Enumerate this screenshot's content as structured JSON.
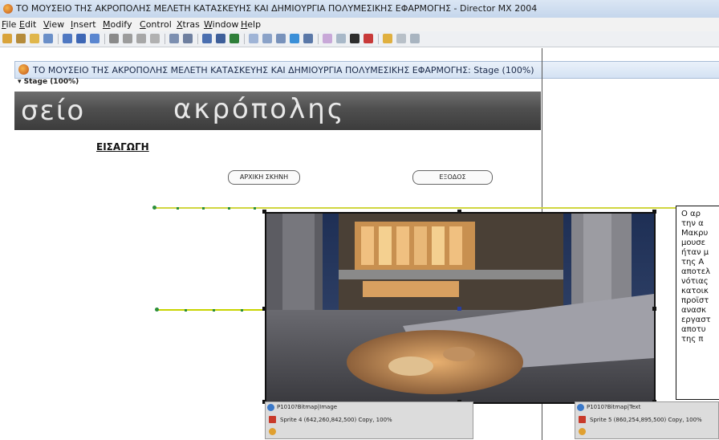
{
  "window": {
    "title": "ΤΟ ΜΟΥΣΕΙΟ ΤΗΣ ΑΚΡΟΠΟΛΗΣ ΜΕΛΕΤΗ ΚΑΤΑΣΚΕΥΗΣ ΚΑΙ ΔΗΜΙΟΥΡΓΙΑ ΠΟΛΥΜΕΣΙΚΗΣ ΕΦΑΡΜΟΓΗΣ - Director MX 2004"
  },
  "menu": {
    "file": "File",
    "edit": "Edit",
    "view": "View",
    "insert": "Insert",
    "modify": "Modify",
    "control": "Control",
    "xtras": "Xtras",
    "window": "Window",
    "help": "Help"
  },
  "stage": {
    "title": "ΤΟ ΜΟΥΣΕΙΟ ΤΗΣ ΑΚΡΟΠΟΛΗΣ ΜΕΛΕΤΗ ΚΑΤΑΣΚΕΥΗΣ ΚΑΙ ΔΗΜΙΟΥΡΓΙΑ ΠΟΛΥΜΕΣΙΚΗΣ ΕΦΑΡΜΟΓΗΣ: Stage (100%)",
    "zoom_label": "▾ Stage (100%)"
  },
  "banner": {
    "word1": "σείο",
    "word2": "ακρόπολης"
  },
  "intro_heading": "ΕΙΣΑΓΩΓΗ",
  "buttons": {
    "home": "ΑΡΧΙΚΗ ΣΚΗΝΗ",
    "exit": "ΕΞΟΔΟΣ"
  },
  "text_panel": {
    "lines": [
      "Ο αρ",
      "την α",
      "Μακρυ",
      "μουσε",
      "ήταν μ",
      "της Α",
      "αποτελ",
      "νότιας",
      "κατοικ",
      "προϊστ",
      "ανασκ",
      "εργαστ",
      "αποτυ",
      "της π"
    ]
  },
  "sprites": [
    {
      "name": "P1010?Bitmap|Image",
      "info": "Sprite 4 (642,260,842,500) Copy, 100%"
    },
    {
      "name": "P1010?Bitmap|Text",
      "info": "Sprite 5 (860,254,895,500) Copy, 100%"
    }
  ],
  "colors": {
    "accent": "#2c8f3a",
    "motion_path": "#c8d400",
    "title_bar": "#c5d6ec"
  }
}
